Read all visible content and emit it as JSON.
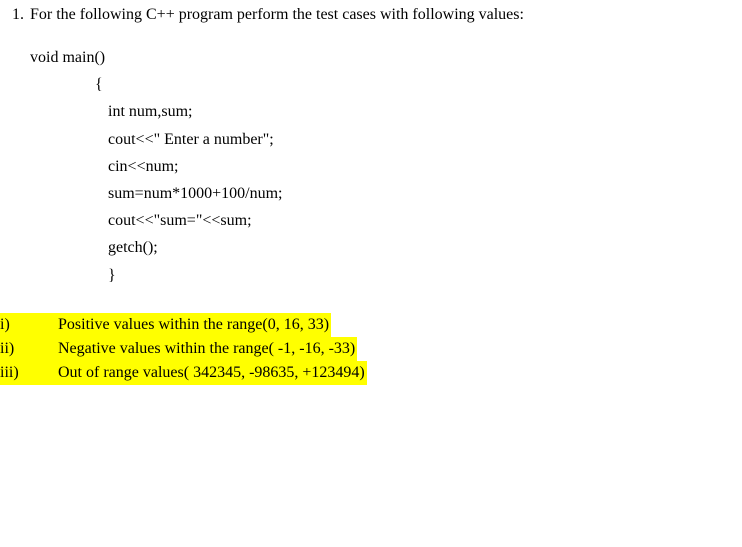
{
  "question": {
    "number": "1.",
    "text": "For the following C++ program perform the test cases with following values:"
  },
  "code": {
    "line1": "void main()",
    "line2": "{",
    "line3": "int num,sum;",
    "line4": "cout<<\" Enter a number\";",
    "line5": "cin<<num;",
    "line6": "sum=num*1000+100/num;",
    "line7": " cout<<\"sum=\"<<sum;",
    "line8": "getch();",
    "line9": " }"
  },
  "options": {
    "i": {
      "label": "i)",
      "text": "Positive values within the range(0, 16, 33)"
    },
    "ii": {
      "label": "ii)",
      "text": "Negative values within the range( -1, -16, -33)"
    },
    "iii": {
      "label": "iii)",
      "text": "Out of range values( 342345, -98635, +123494)"
    }
  }
}
